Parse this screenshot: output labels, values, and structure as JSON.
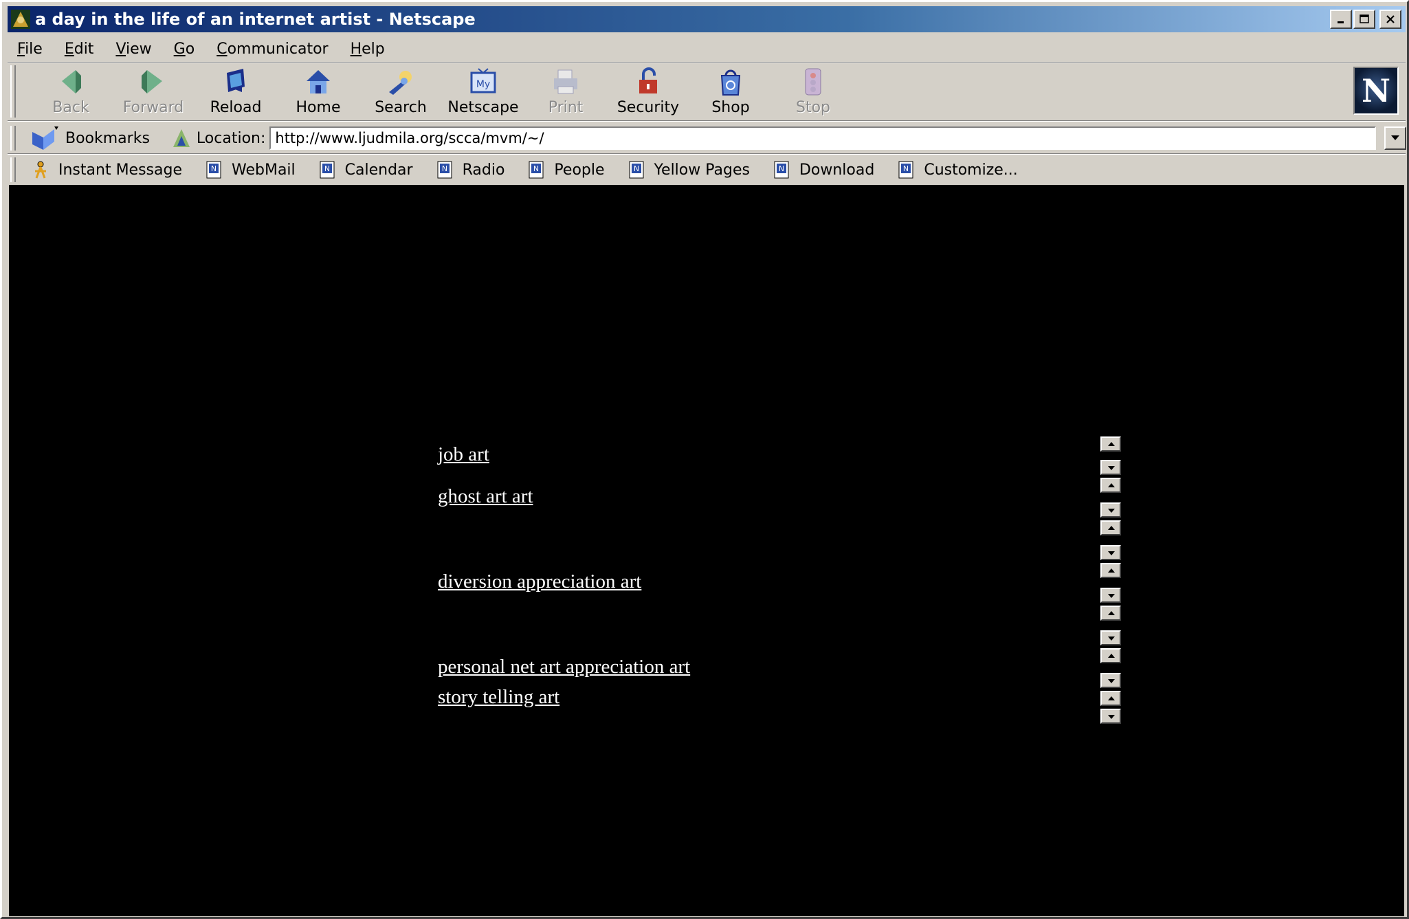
{
  "window": {
    "title": "a day in the life of an internet artist - Netscape"
  },
  "menu": [
    "File",
    "Edit",
    "View",
    "Go",
    "Communicator",
    "Help"
  ],
  "toolbar": [
    {
      "label": "Back",
      "icon": "back-arrow-icon",
      "enabled": false
    },
    {
      "label": "Forward",
      "icon": "forward-arrow-icon",
      "enabled": false
    },
    {
      "label": "Reload",
      "icon": "reload-icon",
      "enabled": true
    },
    {
      "label": "Home",
      "icon": "home-icon",
      "enabled": true
    },
    {
      "label": "Search",
      "icon": "search-icon",
      "enabled": true
    },
    {
      "label": "Netscape",
      "icon": "my-netscape-icon",
      "enabled": true
    },
    {
      "label": "Print",
      "icon": "print-icon",
      "enabled": false
    },
    {
      "label": "Security",
      "icon": "padlock-icon",
      "enabled": true
    },
    {
      "label": "Shop",
      "icon": "shopping-bag-icon",
      "enabled": true
    },
    {
      "label": "Stop",
      "icon": "stop-icon",
      "enabled": false
    }
  ],
  "location": {
    "bookmarks_label": "Bookmarks",
    "location_label": "Location:",
    "url": "http://www.ljudmila.org/scca/mvm/~/"
  },
  "personal_toolbar": [
    "Instant Message",
    "WebMail",
    "Calendar",
    "Radio",
    "People",
    "Yellow Pages",
    "Download",
    "Customize..."
  ],
  "content": {
    "links": [
      "job art ",
      "ghost art art ",
      "diversion appreciation art",
      "personal net art appreciation art ",
      "story telling art "
    ]
  },
  "colors": {
    "page_background": "#000000",
    "link_color": "#ffffff",
    "chrome": "#d4d0c8",
    "titlebar": "#0a246a"
  }
}
